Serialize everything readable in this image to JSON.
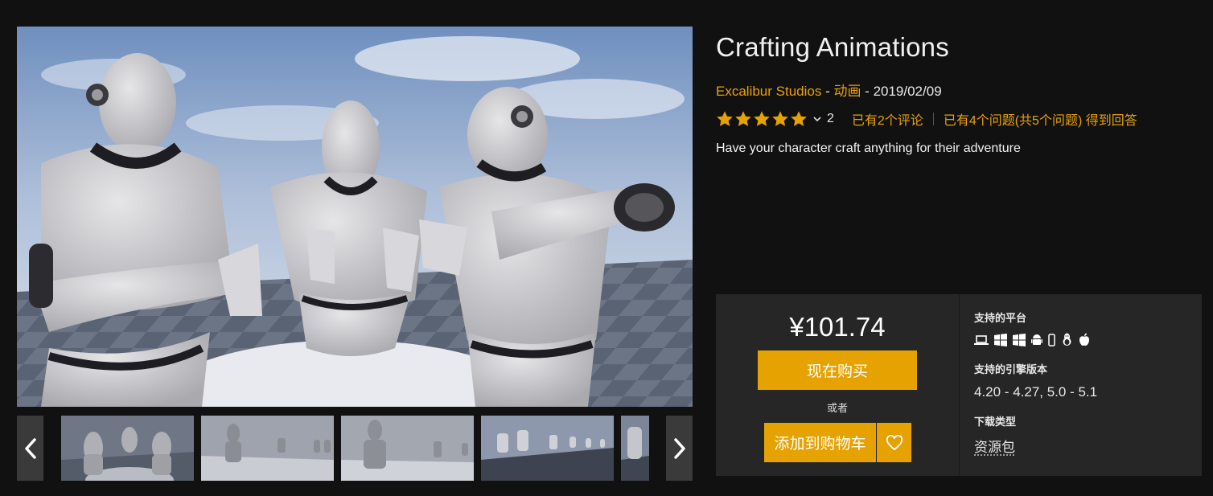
{
  "product": {
    "title": "Crafting Animations",
    "author": "Excalibur Studios",
    "separator1": " - ",
    "category": "动画",
    "separator2": " - ",
    "date": "2019/02/09",
    "rating_count": "2",
    "stars": 5,
    "reviews_link": "已有2个评论",
    "questions_link": "已有4个问题(共5个问题) 得到回答",
    "description": "Have your character craft anything for their adventure"
  },
  "purchase": {
    "price": "¥101.74",
    "buy_label": "现在购买",
    "or_label": "或者",
    "cart_label": "添加到购物车"
  },
  "specs": {
    "platforms_label": "支持的平台",
    "platform_icons": [
      "laptop-icon",
      "windows-icon",
      "windows-icon",
      "android-icon",
      "mobile-icon",
      "linux-icon",
      "apple-icon"
    ],
    "engine_label": "支持的引擎版本",
    "engine_value": "4.20 - 4.27, 5.0 - 5.1",
    "download_label": "下载类型",
    "download_value": "资源包"
  },
  "gallery": {
    "thumbnail_count": 5
  },
  "colors": {
    "accent": "#e5a200",
    "link": "#e8a200",
    "background": "#111111",
    "panel": "#262626"
  }
}
